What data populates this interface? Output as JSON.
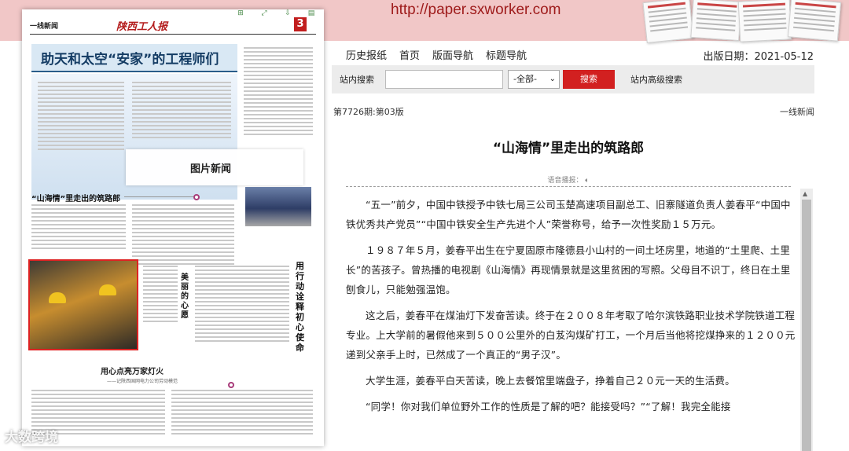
{
  "banner": {
    "url": "http://paper.sxworker.com"
  },
  "newspaper_page": {
    "section": "一线新闻",
    "masthead": "陕西工人报",
    "page_number": "3",
    "headline_top": "助天和太空“安家”的工程师们",
    "picture_news": "图片新闻",
    "headline_article": "“山海情”里走出的筑路郎",
    "vertical_headline": "用行动诠释初心使命",
    "vertical_headline_small": "美丽的心愿",
    "headline_bottom": "用心点亮万家灯火",
    "subline_bottom": "——记陕西国网电力公司劳动模范"
  },
  "watermark": "大数跨境",
  "nav": {
    "items": [
      "历史报纸",
      "首页",
      "版面导航",
      "标题导航"
    ],
    "pub_date": "出版日期：2021-05-12"
  },
  "search": {
    "label": "站内搜索",
    "placeholder": "",
    "scope": "-全部-",
    "button": "搜索",
    "advanced": "站内高级搜索"
  },
  "article_meta": {
    "issue": "第7726期:第03版",
    "section": "一线新闻"
  },
  "article": {
    "title": "“山海情”里走出的筑路郎",
    "tts_label": "语音播报：",
    "paragraphs": [
      "“五一”前夕，中国中铁授予中铁七局三公司玉楚高速项目副总工、旧寨隧道负责人姜春平“中国中铁优秀共产党员”“中国中铁安全生产先进个人”荣誉称号，给予一次性奖励１５万元。",
      "１９８７年５月，姜春平出生在宁夏固原市隆德县小山村的一间土坯房里，地道的“土里爬、土里长”的苦孩子。曾热播的电视剧《山海情》再现情景就是这里贫困的写照。父母目不识丁，终日在土里刨食儿，只能勉强温饱。",
      "这之后，姜春平在煤油灯下发奋苦读。终于在２００８年考取了哈尔滨铁路职业技术学院铁道工程专业。上大学前的暑假他来到５００公里外的白芨沟煤矿打工，一个月后当他将挖煤挣来的１２００元递到父亲手上时，已然成了一个真正的“男子汉”。",
      "大学生涯，姜春平白天苦读，晚上去餐馆里端盘子，挣着自己２０元一天的生活费。",
      "“同学！你对我们单位野外工作的性质是了解的吧？能接受吗？”“了解！我完全能接"
    ]
  }
}
